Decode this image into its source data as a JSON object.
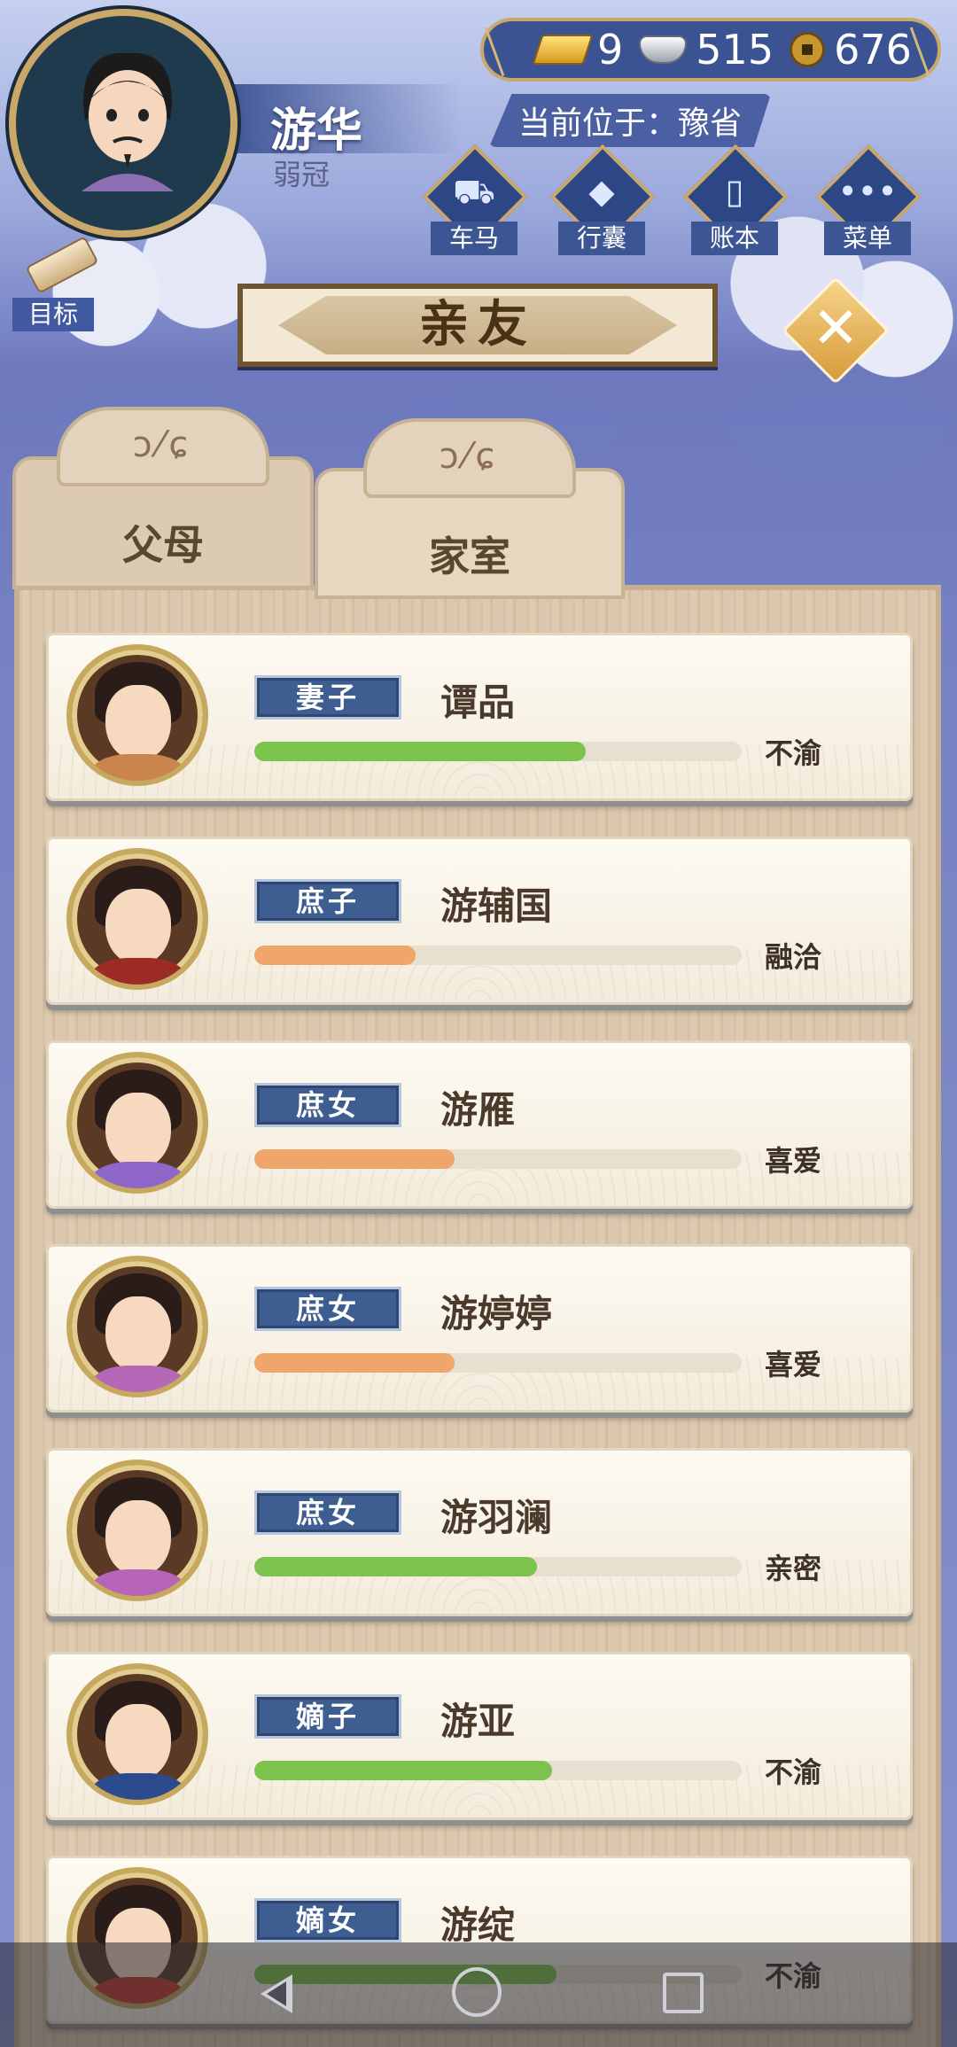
{
  "player": {
    "name": "游华",
    "age_title": "弱冠"
  },
  "resources": {
    "gold": "9",
    "silver": "515",
    "coins": "676"
  },
  "location": {
    "label": "当前位于：豫省"
  },
  "menu": {
    "carriage": "车马",
    "bag": "行囊",
    "ledger": "账本",
    "menu": "菜单",
    "goal": "目标"
  },
  "page": {
    "title": "亲友",
    "close_glyph": "✕"
  },
  "tabs": {
    "parents": "父母",
    "family": "家室",
    "ornament": "ɔ⁄ɕ"
  },
  "colors": {
    "bar_green": "#7cc34d",
    "bar_orange": "#f0a56a"
  },
  "members": [
    {
      "role": "妻子",
      "name": "谭品",
      "relation": "不渝",
      "affinity": 0.68,
      "color": "green",
      "body": "#c9854d"
    },
    {
      "role": "庶子",
      "name": "游辅国",
      "relation": "融洽",
      "affinity": 0.33,
      "color": "orange",
      "body": "#9c2b26"
    },
    {
      "role": "庶女",
      "name": "游雁",
      "relation": "喜爱",
      "affinity": 0.41,
      "color": "orange",
      "body": "#8e67c8"
    },
    {
      "role": "庶女",
      "name": "游婷婷",
      "relation": "喜爱",
      "affinity": 0.41,
      "color": "orange",
      "body": "#b668b8"
    },
    {
      "role": "庶女",
      "name": "游羽澜",
      "relation": "亲密",
      "affinity": 0.58,
      "color": "green",
      "body": "#b564b8"
    },
    {
      "role": "嫡子",
      "name": "游亚",
      "relation": "不渝",
      "affinity": 0.61,
      "color": "green",
      "body": "#2c4a8e"
    },
    {
      "role": "嫡女",
      "name": "游绽",
      "relation": "不渝",
      "affinity": 0.62,
      "color": "green",
      "body": "#c73b32"
    }
  ]
}
